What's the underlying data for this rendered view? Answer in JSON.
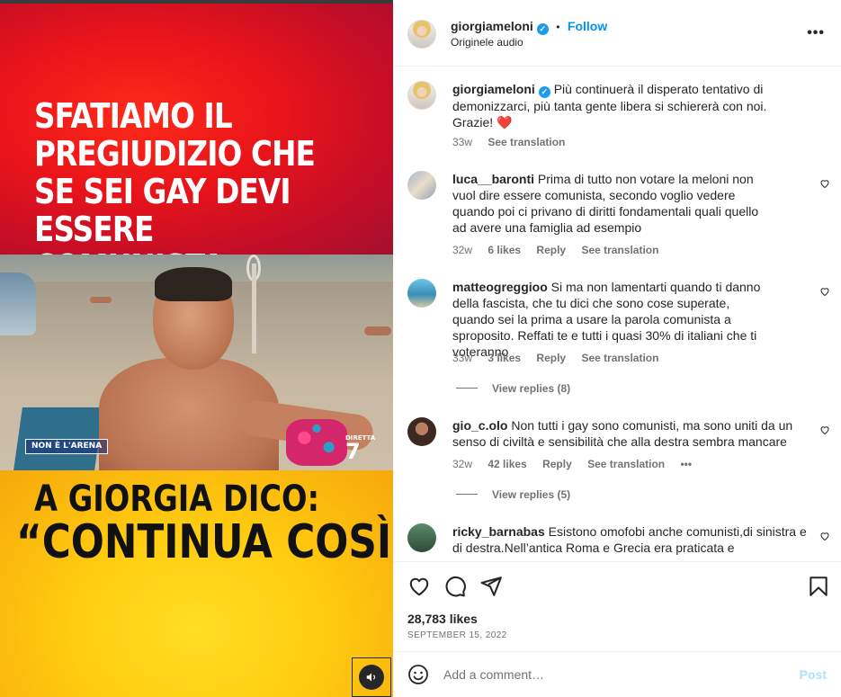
{
  "media": {
    "headline": "SFATIAMO IL PREGIUDIZIO CHE SE SEI GAY DEVI ESSERE COMUNISTA",
    "subtitle_line1": "A GIORGIA DICO:",
    "subtitle_line2": "“CONTINUA COSÌ”",
    "logo_left": "NON È L'ARENA",
    "logo_right_small": "DIRETTA",
    "logo_right_big": "7",
    "audio_icon": "speaker-icon"
  },
  "post_header": {
    "username": "giorgiameloni",
    "separator": "•",
    "follow_label": "Follow",
    "audio_label": "Originele audio",
    "more_label": "•••"
  },
  "caption": {
    "username": "giorgiameloni",
    "text": "Più continuerà il disperato tentativo di demonizzarci, più tanta gente libera si schiererà con noi. Grazie! ❤️",
    "time": "33w",
    "translate": "See translation"
  },
  "comments": [
    {
      "username": "luca__baronti",
      "text": "Prima di tutto non votare la meloni non vuol dire essere comunista, secondo voglio vedere quando poi ci privano di diritti fondamentali quali quello ad avere una famiglia ad esempio",
      "time": "32w",
      "likes": "6 likes",
      "reply": "Reply",
      "translate": "See translation"
    },
    {
      "username": "matteogreggioo",
      "text": "Si ma non lamentarti quando ti danno della fascista, che tu dici che sono cose superate, quando sei la prima a usare la parola comunista a sproposito. Reffati te e tutti i quasi 30% di italiani che ti voteranno",
      "time": "33w",
      "likes": "3 likes",
      "reply": "Reply",
      "translate": "See translation",
      "view_replies": "View replies (8)"
    },
    {
      "username": "gio_c.olo",
      "text": "Non tutti i gay sono comunisti, ma sono uniti da un senso di civiltà e sensibilità che alla destra sembra mancare",
      "time": "32w",
      "likes": "42 likes",
      "reply": "Reply",
      "translate": "See translation",
      "more": "•••",
      "view_replies": "View replies (5)"
    },
    {
      "username": "ricky_barnabas",
      "text": "Esistono omofobi anche comunisti,di sinistra e di destra.Nell’antica Roma e Grecia era praticata e"
    }
  ],
  "actions": {
    "likes": "28,783 likes",
    "date": "SEPTEMBER 15, 2022"
  },
  "add_comment": {
    "placeholder": "Add a comment…",
    "post_label": "Post"
  },
  "colors": {
    "accent": "#0095f6",
    "verified": "#1d9bf0",
    "muted": "#737373",
    "post_disabled": "#b2dffc"
  }
}
